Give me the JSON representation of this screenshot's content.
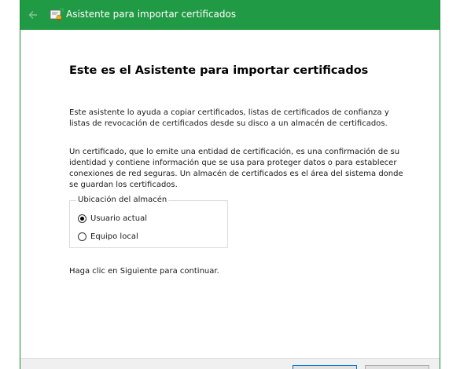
{
  "window": {
    "title": "Asistente para importar certificados"
  },
  "colors": {
    "titlebar": "#219a45",
    "accent_button_border": "#0078d7"
  },
  "icons": {
    "back": "back-arrow-icon",
    "app": "certificate-icon"
  },
  "main": {
    "heading": "Este es el Asistente para importar certificados",
    "paragraph1": "Este asistente lo ayuda a copiar certificados, listas de certificados de confianza y listas de revocación de certificados desde su disco a un almacén de certificados.",
    "paragraph2": "Un certificado, que lo emite una entidad de certificación, es una confirmación de su identidad y contiene información que se usa para proteger datos o para establecer conexiones de red seguras. Un almacén de certificados es el área del sistema donde se guardan los certificados.",
    "store_location": {
      "legend": "Ubicación del almacén",
      "options": [
        {
          "label": "Usuario actual",
          "selected": true
        },
        {
          "label": "Equipo local",
          "selected": false
        }
      ]
    },
    "paragraph3": "Haga clic en Siguiente para continuar."
  }
}
